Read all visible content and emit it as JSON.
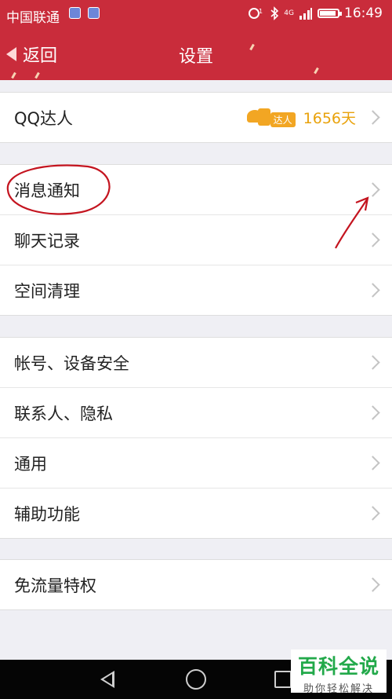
{
  "status": {
    "carrier": "中国联通",
    "network": "4G",
    "time": "16:49",
    "battery_level": 0.9
  },
  "nav": {
    "back_label": "返回",
    "title": "设置"
  },
  "groups": [
    {
      "rows": [
        {
          "label": "QQ达人",
          "badge_tag": "达人",
          "badge_days": "1656天"
        }
      ]
    },
    {
      "rows": [
        {
          "label": "消息通知"
        },
        {
          "label": "聊天记录"
        },
        {
          "label": "空间清理"
        }
      ]
    },
    {
      "rows": [
        {
          "label": "帐号、设备安全"
        },
        {
          "label": "联系人、隐私"
        },
        {
          "label": "通用"
        },
        {
          "label": "辅助功能"
        }
      ]
    },
    {
      "rows": [
        {
          "label": "免流量特权"
        }
      ]
    }
  ],
  "watermark": {
    "title": "百科全说",
    "subtitle": "助你轻松解决"
  },
  "colors": {
    "header": "#c92c3b",
    "badge": "#e9a20b",
    "annotation": "#c4141f"
  }
}
